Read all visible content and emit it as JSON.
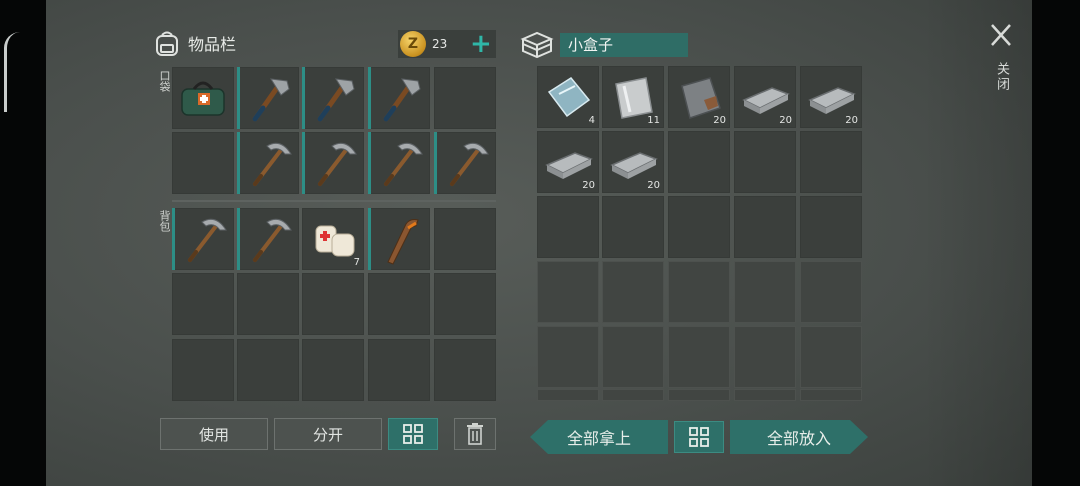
{
  "inventory": {
    "title": "物品栏",
    "coins": "23",
    "pocket_label": "口袋",
    "backpack_label": "背包",
    "pocket_slots": [
      {
        "item": "medkit-bag",
        "count": ""
      },
      {
        "item": "hammer",
        "count": ""
      },
      {
        "item": "hammer",
        "count": ""
      },
      {
        "item": "hammer",
        "count": ""
      },
      {
        "item": "",
        "count": ""
      },
      {
        "item": "",
        "count": ""
      },
      {
        "item": "pickaxe",
        "count": ""
      },
      {
        "item": "pickaxe",
        "count": ""
      },
      {
        "item": "pickaxe",
        "count": ""
      },
      {
        "item": "pickaxe",
        "count": ""
      }
    ],
    "backpack_slots": [
      {
        "item": "pickaxe",
        "count": ""
      },
      {
        "item": "pickaxe",
        "count": ""
      },
      {
        "item": "bandage",
        "count": "7"
      },
      {
        "item": "hockey-stick",
        "count": ""
      },
      {
        "item": "",
        "count": ""
      },
      {
        "item": "",
        "count": ""
      },
      {
        "item": "",
        "count": ""
      },
      {
        "item": "",
        "count": ""
      },
      {
        "item": "",
        "count": ""
      },
      {
        "item": "",
        "count": ""
      },
      {
        "item": "",
        "count": ""
      },
      {
        "item": "",
        "count": ""
      },
      {
        "item": "",
        "count": ""
      },
      {
        "item": "",
        "count": ""
      },
      {
        "item": "",
        "count": ""
      }
    ],
    "buttons": {
      "use": "使用",
      "split": "分开"
    }
  },
  "container": {
    "title": "小盒子",
    "slots": [
      {
        "item": "glass-pane",
        "count": "4"
      },
      {
        "item": "sheet-metal",
        "count": "11"
      },
      {
        "item": "rusty-plate",
        "count": "20"
      },
      {
        "item": "iron-ingot",
        "count": "20"
      },
      {
        "item": "iron-ingot",
        "count": "20"
      },
      {
        "item": "iron-ingot",
        "count": "20"
      },
      {
        "item": "iron-ingot",
        "count": "20"
      }
    ],
    "buttons": {
      "take_all": "全部拿上",
      "put_all": "全部放入"
    }
  },
  "close_label": "关闭",
  "colors": {
    "accent": "#2e7069",
    "teal_edge": "#2d8e86",
    "plus": "#2fb7a8"
  }
}
